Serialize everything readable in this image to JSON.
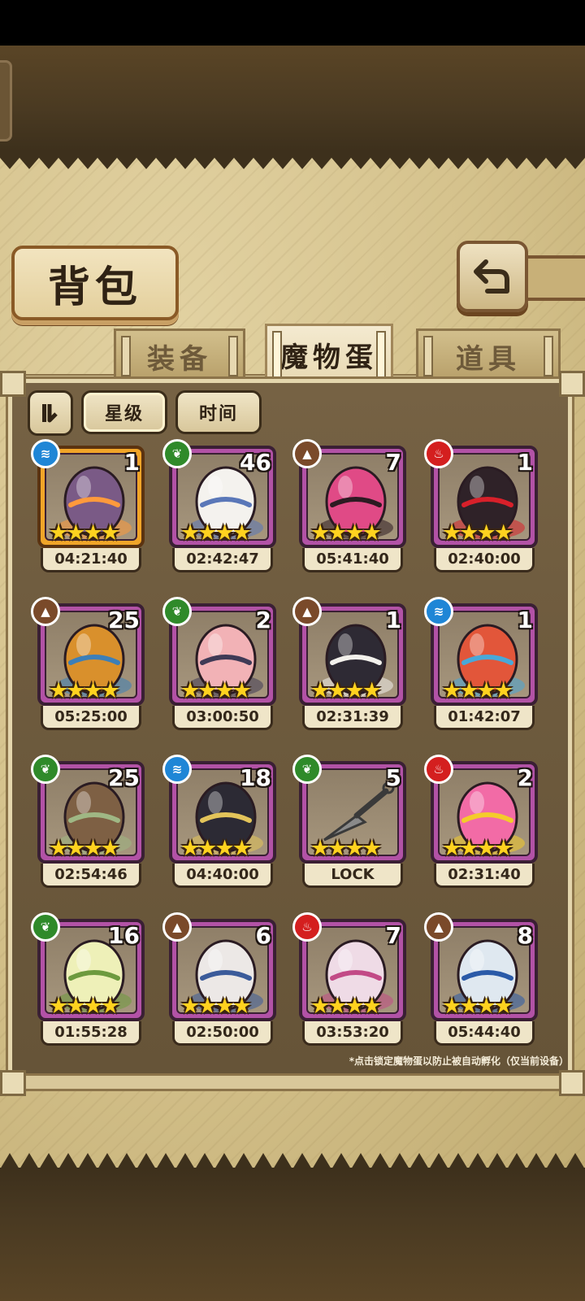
{
  "screen": {
    "title": "背包",
    "back_icon": "back-arrow-icon"
  },
  "tabs": [
    {
      "label": "装备",
      "active": false
    },
    {
      "label": "魔物蛋",
      "active": true
    },
    {
      "label": "道具",
      "active": false
    }
  ],
  "toolbar": {
    "sort_icon": "sort-order-icon",
    "filters": [
      {
        "label": "星级",
        "active": true
      },
      {
        "label": "时间",
        "active": false
      }
    ]
  },
  "element_colors": {
    "water": "#1f86d6",
    "nature": "#2f8a2a",
    "earth": "#7a4a2a",
    "fire": "#d41f1f"
  },
  "eggs": [
    {
      "element": "water",
      "count": "1",
      "stars": 4,
      "timer": "04:21:40",
      "frame": "gold",
      "art": "purple-eye-egg"
    },
    {
      "element": "nature",
      "count": "46",
      "stars": 4,
      "timer": "02:42:47",
      "frame": "purple",
      "art": "white-feather-egg"
    },
    {
      "element": "earth",
      "count": "7",
      "stars": 4,
      "timer": "05:41:40",
      "frame": "purple",
      "art": "pink-thorn-egg"
    },
    {
      "element": "fire",
      "count": "1",
      "stars": 4,
      "timer": "02:40:00",
      "frame": "purple",
      "art": "dark-crystal-egg"
    },
    {
      "element": "earth",
      "count": "25",
      "stars": 4,
      "timer": "05:25:00",
      "frame": "purple",
      "art": "furry-gem-egg"
    },
    {
      "element": "nature",
      "count": "2",
      "stars": 4,
      "timer": "03:00:50",
      "frame": "purple",
      "art": "pink-bunny-egg"
    },
    {
      "element": "earth",
      "count": "1",
      "stars": 4,
      "timer": "02:31:39",
      "frame": "purple",
      "art": "panda-egg"
    },
    {
      "element": "water",
      "count": "1",
      "stars": 4,
      "timer": "01:42:07",
      "frame": "purple",
      "art": "feather-crown-egg"
    },
    {
      "element": "nature",
      "count": "25",
      "stars": 4,
      "timer": "02:54:46",
      "frame": "purple",
      "art": "striped-leaf-egg"
    },
    {
      "element": "water",
      "count": "18",
      "stars": 4,
      "timer": "04:40:00",
      "frame": "purple",
      "art": "anubis-egg"
    },
    {
      "element": "nature",
      "count": "5",
      "stars": 4,
      "timer": "LOCK",
      "frame": "purple",
      "art": "kunai-locked"
    },
    {
      "element": "fire",
      "count": "2",
      "stars": 4,
      "timer": "02:31:40",
      "frame": "purple",
      "art": "pink-jelly-crown-egg"
    },
    {
      "element": "nature",
      "count": "16",
      "stars": 4,
      "timer": "01:55:28",
      "frame": "purple",
      "art": "green-leaf-egg"
    },
    {
      "element": "earth",
      "count": "6",
      "stars": 4,
      "timer": "02:50:00",
      "frame": "purple",
      "art": "wing-white-egg"
    },
    {
      "element": "fire",
      "count": "7",
      "stars": 4,
      "timer": "03:53:20",
      "frame": "purple",
      "art": "bat-pink-egg"
    },
    {
      "element": "earth",
      "count": "8",
      "stars": 4,
      "timer": "05:44:40",
      "frame": "purple",
      "art": "blue-crystal-egg"
    }
  ],
  "footnote": "*点击锁定魔物蛋以防止被自动孵化（仅当前设备）"
}
